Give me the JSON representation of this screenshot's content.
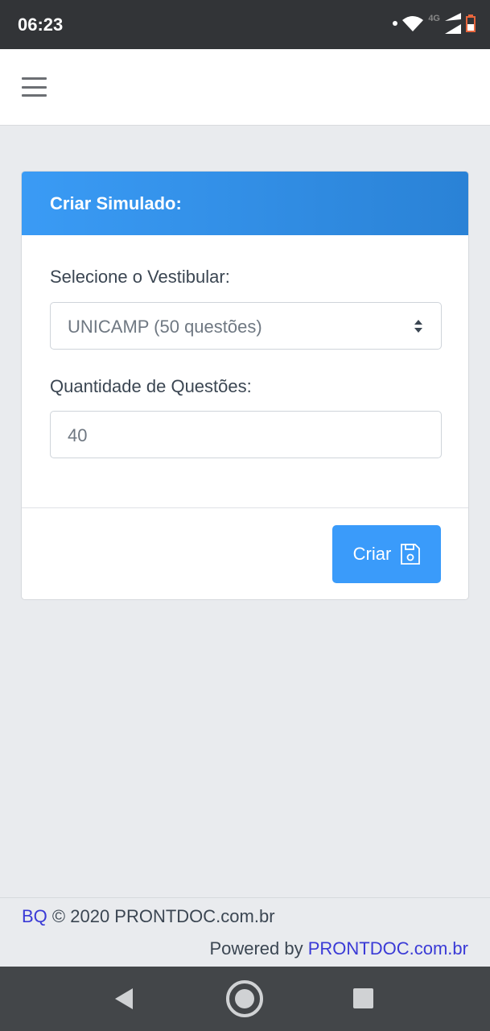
{
  "status": {
    "time": "06:23",
    "network": "4G"
  },
  "card": {
    "title": "Criar Simulado:",
    "vestibular_label": "Selecione o Vestibular:",
    "vestibular_value": "UNICAMP (50 questões)",
    "quantidade_label": "Quantidade de Questões:",
    "quantidade_value": "40",
    "button_label": "Criar"
  },
  "footer": {
    "brand": "BQ",
    "copyright": " © 2020 PRONTDOC.com.br",
    "powered_prefix": "Powered by ",
    "powered_link": "PRONTDOC.com.br"
  }
}
